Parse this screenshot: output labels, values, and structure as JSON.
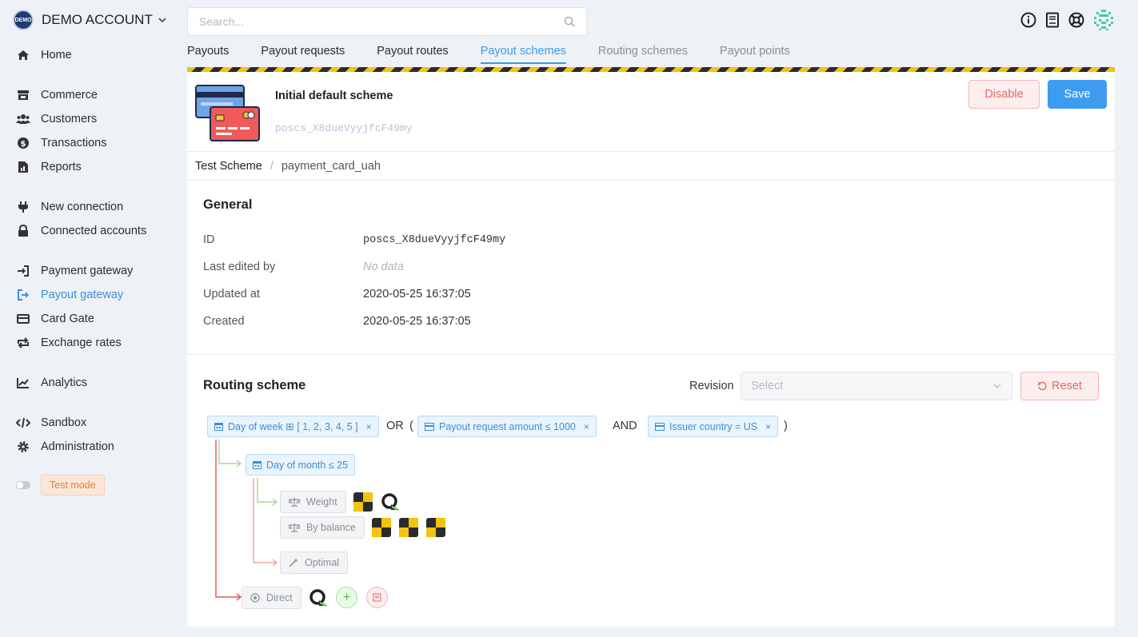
{
  "account": {
    "logo_text": "DEMO",
    "name": "DEMO ACCOUNT"
  },
  "sidebar": {
    "items": [
      {
        "label": "Home",
        "icon": "home-icon"
      },
      {
        "label": "Commerce",
        "icon": "store-icon"
      },
      {
        "label": "Customers",
        "icon": "users-icon"
      },
      {
        "label": "Transactions",
        "icon": "dollar-icon"
      },
      {
        "label": "Reports",
        "icon": "report-icon"
      },
      {
        "label": "New connection",
        "icon": "plug-icon"
      },
      {
        "label": "Connected accounts",
        "icon": "lock-icon"
      },
      {
        "label": "Payment gateway",
        "icon": "sign-in-icon"
      },
      {
        "label": "Payout gateway",
        "icon": "sign-out-icon",
        "active": true
      },
      {
        "label": "Card Gate",
        "icon": "credit-card-icon"
      },
      {
        "label": "Exchange rates",
        "icon": "exchange-icon"
      },
      {
        "label": "Analytics",
        "icon": "chart-line-icon"
      },
      {
        "label": "Sandbox",
        "icon": "code-icon"
      },
      {
        "label": "Administration",
        "icon": "gear-icon"
      }
    ],
    "test_mode_label": "Test mode"
  },
  "search": {
    "placeholder": "Search..."
  },
  "tabs": [
    {
      "label": "Payouts"
    },
    {
      "label": "Payout requests"
    },
    {
      "label": "Payout routes"
    },
    {
      "label": "Payout schemes",
      "active": true
    },
    {
      "label": "Routing schemes",
      "muted": true
    },
    {
      "label": "Payout points",
      "muted": true
    }
  ],
  "scheme": {
    "title": "Initial default scheme",
    "id": "poscs_X8dueVyyjfcF49my",
    "disable_label": "Disable",
    "save_label": "Save"
  },
  "breadcrumb": {
    "first": "Test Scheme",
    "separator": "/",
    "second": "payment_card_uah"
  },
  "general": {
    "title": "General",
    "rows": [
      {
        "label": "ID",
        "value": "poscs_X8dueVyyjfcF49my"
      },
      {
        "label": "Last edited by",
        "value": "No data"
      },
      {
        "label": "Updated at",
        "value": "2020-05-25 16:37:05"
      },
      {
        "label": "Created",
        "value": "2020-05-25 16:37:05"
      }
    ]
  },
  "routing": {
    "title": "Routing scheme",
    "revision_label": "Revision",
    "revision_placeholder": "Select",
    "reset_label": "Reset",
    "conditions": [
      {
        "text": "Day of week ⊞ [ 1, 2, 3, 4, 5 ]",
        "icon": "calendar-icon"
      },
      {
        "text": "Payout request amount ≤ 1000",
        "icon": "credit-card-icon"
      },
      {
        "text": "Issuer country = US",
        "icon": "credit-card-icon"
      }
    ],
    "operators": {
      "or": "OR",
      "open": "(",
      "and": "AND",
      "close": ")"
    },
    "sub_condition": {
      "text": "Day of month ≤ 25",
      "icon": "calendar-icon"
    },
    "nodes": {
      "weight": "Weight",
      "by_balance": "By balance",
      "optimal": "Optimal",
      "direct": "Direct"
    },
    "colors": {
      "green_branch": "#a8dc98",
      "red_branch": "#e45b5b",
      "chip_blue": "#3a8fd8"
    }
  }
}
